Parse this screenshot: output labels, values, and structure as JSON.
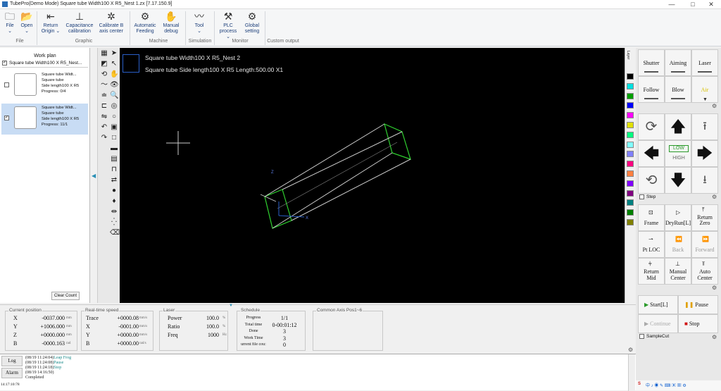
{
  "window": {
    "title": "TubePro(Demo Mode) Square tube Width100 X R5_Nest 1.zx  [7.17.150.9]",
    "min": "—",
    "max": "□",
    "close": "✕"
  },
  "ribbon": {
    "buttons": [
      {
        "label": "File",
        "sub": "⌄",
        "icon": "🗀"
      },
      {
        "label": "Open",
        "sub": "⌄",
        "icon": "📂"
      },
      {
        "label": "Return Origin",
        "sub": "⌄",
        "icon": "⇤"
      },
      {
        "label": "Capacitance calibration",
        "sub": "",
        "icon": "⊥"
      },
      {
        "label": "Calibrate B axis center",
        "sub": "",
        "icon": "✲"
      },
      {
        "label": "Automatic Feeding",
        "sub": "",
        "icon": "⚙"
      },
      {
        "label": "Manual debug",
        "sub": "",
        "icon": "✋"
      },
      {
        "label": "Tool",
        "sub": "⌄",
        "icon": "〰"
      },
      {
        "label": "PLC process",
        "sub": "⌄",
        "icon": "⚒"
      },
      {
        "label": "Global setting",
        "sub": "",
        "icon": "⚙"
      }
    ],
    "groups": [
      "File",
      "Graphic",
      "Machine",
      "Simulation",
      "Monitor",
      "Custom output"
    ]
  },
  "workplan": {
    "title": "Work plan",
    "selected": "Square tube Width100 X R5_Nest...",
    "parts": [
      {
        "lines": [
          "Square tube Widt...",
          "Square tube",
          "Side length100 X R5",
          "Progress: 0/4"
        ],
        "checked": false
      },
      {
        "lines": [
          "Square tube Widt...",
          "Square tube",
          "Side length100 X R5",
          "Progress: 11/1"
        ],
        "checked": true
      }
    ],
    "clear": "Clear Count"
  },
  "canvas": {
    "line1": "Square tube Width100 X R5_Nest 2",
    "line2": "Square tube Side length100 X R5 Length:500.00  X1",
    "axis_x": "X",
    "axis_z": "Z"
  },
  "layer_tab": "Layer",
  "colors": [
    "#000000",
    "#00e0e0",
    "#00a000",
    "#0000ff",
    "#ff00ff",
    "#e0e000",
    "#00ff80",
    "#80ffff",
    "#8080ff",
    "#ff0080",
    "#ff8040",
    "#8000ff",
    "#800080",
    "#008080",
    "#008000",
    "#808000"
  ],
  "right": {
    "row1": [
      "Shutter",
      "Aiming",
      "Laser"
    ],
    "row2": [
      "Follow",
      "Blow",
      "Air"
    ],
    "speed_low": "LOW",
    "speed_high": "HIGH",
    "step": "Step",
    "row3": [
      "Frame",
      "DryRun[L]",
      "Return Zero"
    ],
    "row4": [
      "Pt LOC",
      "Back",
      "Forward"
    ],
    "row5": [
      "Return Mid",
      "Manual Center",
      "Auto Center"
    ],
    "start": "Start[L]",
    "pause": "Pause",
    "continue": "Continue",
    "stop": "Stop",
    "samplecut": "SampleCut"
  },
  "status": {
    "current": {
      "cap": "Current position",
      "rows": [
        {
          "k": "X",
          "v": "-0037.000",
          "u": "mm"
        },
        {
          "k": "Y",
          "v": "+1006.000",
          "u": "mm"
        },
        {
          "k": "Z",
          "v": "+0000.000",
          "u": "mm"
        },
        {
          "k": "B",
          "v": "-0000.163",
          "u": "rad"
        }
      ]
    },
    "speed": {
      "cap": "Real-time speed",
      "rows": [
        {
          "k": "Trace",
          "v": "+0000.08",
          "u": "mm/s"
        },
        {
          "k": "X",
          "v": "-0001.00",
          "u": "mm/s"
        },
        {
          "k": "Y",
          "v": "+0000.00",
          "u": "mm/s"
        },
        {
          "k": "B",
          "v": "+0000.00",
          "u": "rad/s"
        }
      ]
    },
    "laser": {
      "cap": "Laser",
      "rows": [
        {
          "k": "Power",
          "v": "100.0",
          "u": "%"
        },
        {
          "k": "Ratio",
          "v": "100.0",
          "u": "%"
        },
        {
          "k": "Freq",
          "v": "1000",
          "u": "Hz"
        }
      ]
    },
    "schedule": {
      "cap": "Schedule",
      "rows": [
        {
          "k": "Progress",
          "v": "1/1"
        },
        {
          "k": "Total time",
          "v": "0-00:01:12"
        },
        {
          "k": "Done",
          "v": "3"
        },
        {
          "k": "Work Time",
          "v": "3"
        },
        {
          "k": "urrent file cou:",
          "v": "0"
        }
      ]
    },
    "common": {
      "cap": "Common Axis Pos1~6"
    }
  },
  "log": {
    "log_btn": "Log",
    "alarm_btn": "Alarm",
    "time": "14:17:10:78",
    "lines": [
      {
        "t": "(08/19 11:24:04)",
        "m": "Leap Frog"
      },
      {
        "t": "(08/19 11:24:08)",
        "m": "Pause"
      },
      {
        "t": "(08/19 11:24:18)",
        "m": "Stop"
      },
      {
        "t": "(08/19 14:16:50)",
        "m": ""
      },
      {
        "t": "Completed",
        "m": ""
      }
    ]
  }
}
